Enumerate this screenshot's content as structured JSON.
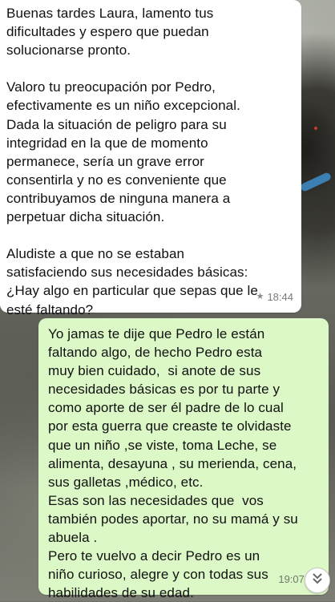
{
  "chat": {
    "incoming": {
      "text": "Buenas tardes Laura, lamento tus\ndificultades y espero que puedan\nsolucionarse pronto.\n\nValoro tu preocupación por Pedro,\nefectivamente es un niño excepcional.\nDada la situación de peligro para su\nintegridad en la que de momento\npermanece, sería un grave error\nconsentirla y no es conveniente que\ncontribuyamos de ninguna manera a\nperpetuar dicha situación.\n\nAludiste a que no se estaban\nsatisfaciendo sus necesidades básicas:\n¿Hay algo en particular que sepas que le\nesté faltando?",
      "starred_icon": "star-icon",
      "time": "18:44"
    },
    "outgoing": {
      "text": "Yo jamas te dije que Pedro le están\nfaltando algo, de hecho Pedro esta\nmuy bien cuidado,  si anote de sus\nnecesidades básicas es por tu parte y\ncomo aporte de ser él padre de lo cual\npor esta guerra que creaste te olvidaste\nque un niño ,se viste, toma Leche, se\nalimenta, desayuna , su merienda, cena,\nsus galletas ,médico, etc.\nEsas son las necesidades que  vos\ntambién podes aportar, no su mamá y su\nabuela .\nPero te vuelvo a decir Pedro es un\nniño curioso, alegre y con todas sus\nhabilidades de su edad.",
      "time": "19:07",
      "status_icon": "double-check-icon"
    }
  },
  "controls": {
    "scroll_down_icon": "chevron-double-down-icon"
  },
  "colors": {
    "incoming_bubble": "#ffffff",
    "outgoing_bubble": "#dcf8c6"
  }
}
